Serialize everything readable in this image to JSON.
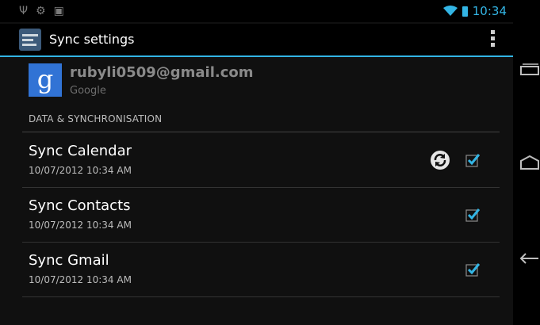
{
  "status_bar": {
    "time": "10:34"
  },
  "action_bar": {
    "title": "Sync settings"
  },
  "account": {
    "email": "rubyli0509@gmail.com",
    "type": "Google",
    "icon_letter": "g"
  },
  "section_header": "DATA & SYNCHRONISATION",
  "sync_items": [
    {
      "title": "Sync Calendar",
      "timestamp": "10/07/2012 10:34 AM",
      "checked": true,
      "syncing": true
    },
    {
      "title": "Sync Contacts",
      "timestamp": "10/07/2012 10:34 AM",
      "checked": true,
      "syncing": false
    },
    {
      "title": "Sync Gmail",
      "timestamp": "10/07/2012 10:34 AM",
      "checked": true,
      "syncing": false
    }
  ],
  "colors": {
    "accent": "#33b5e5",
    "background": "#101010",
    "google_blue": "#3173d5"
  }
}
